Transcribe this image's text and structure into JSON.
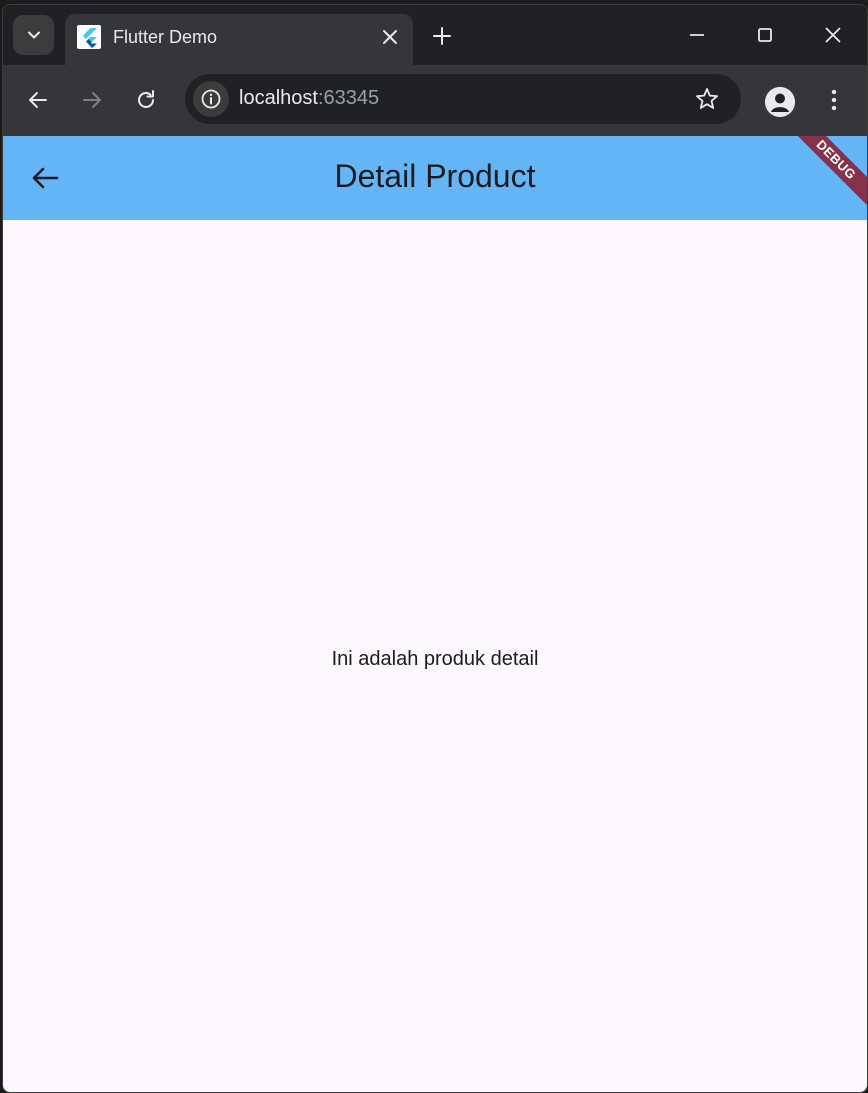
{
  "browser": {
    "tab": {
      "title": "Flutter Demo"
    },
    "address": {
      "host": "localhost",
      "port": ":63345"
    }
  },
  "app": {
    "appbar": {
      "title": "Detail Product",
      "color": "#64b5f6"
    },
    "debug_banner": "DEBUG",
    "body_text": "Ini adalah produk detail"
  },
  "icons": {
    "tab_search": "chevron-down-icon",
    "favicon": "flutter-logo-icon",
    "tab_close": "close-icon",
    "new_tab": "plus-icon",
    "minimize": "minimize-icon",
    "maximize": "maximize-icon",
    "window_close": "close-icon",
    "back": "arrow-left-icon",
    "forward": "arrow-right-icon",
    "reload": "reload-icon",
    "site_info": "info-icon",
    "bookmark": "star-icon",
    "profile": "avatar-icon",
    "menu": "more-vert-icon"
  }
}
